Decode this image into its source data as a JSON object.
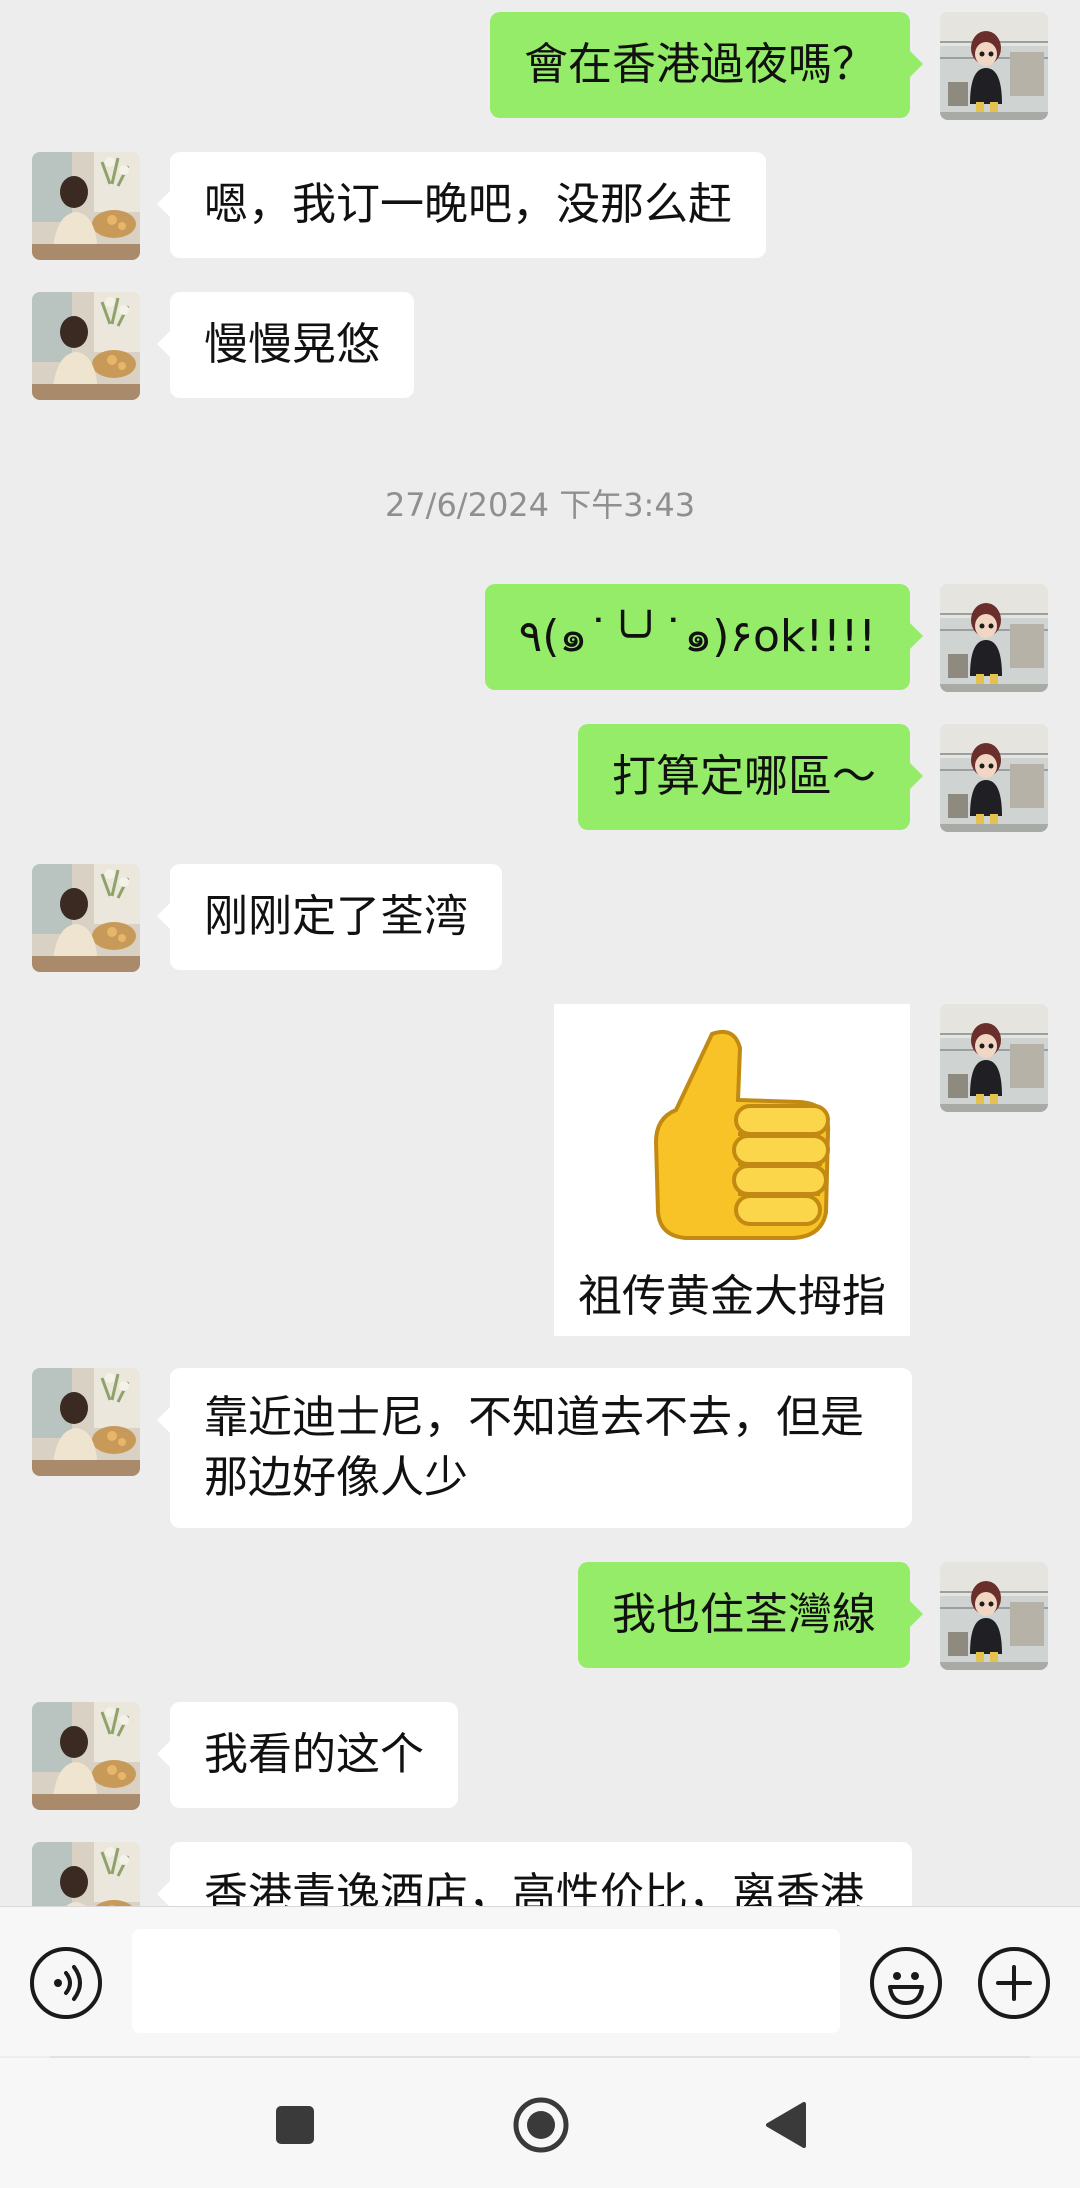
{
  "chat": {
    "messages": [
      {
        "side": "out",
        "text": "會在香港過夜嗎？"
      },
      {
        "side": "in",
        "text": "嗯，我订一晚吧，没那么赶"
      },
      {
        "side": "in",
        "text": "慢慢晃悠"
      },
      {
        "side": "out",
        "text": "٩(๑˙╰╯˙๑)۶ok!!!!"
      },
      {
        "side": "out",
        "text": "打算定哪區～"
      },
      {
        "side": "in",
        "text": "刚刚定了荃湾"
      },
      {
        "side": "in",
        "text": "靠近迪士尼，不知道去不去，但是那边好像人少"
      },
      {
        "side": "out",
        "text": "我也住荃灣線"
      },
      {
        "side": "in",
        "text": "我看的这个"
      },
      {
        "side": "in",
        "text": "香港青逸酒店，高性价比，离香港"
      }
    ],
    "timestamp": "27/6/2024 下午3:43",
    "sticker": {
      "caption": "祖传黄金大拇指",
      "icon": "thumbs-up-emoji"
    }
  },
  "input_bar": {
    "voice_icon": "voice-icon",
    "text_value": "",
    "emoji_icon": "emoji-icon",
    "plus_icon": "plus-icon"
  },
  "nav_bar": {
    "recents_icon": "square-icon",
    "home_icon": "circle-icon",
    "back_icon": "triangle-back-icon"
  },
  "colors": {
    "background": "#ededed",
    "bubble_out": "#95ec69",
    "bubble_in": "#ffffff",
    "timestamp_text": "#8f8f8f"
  }
}
